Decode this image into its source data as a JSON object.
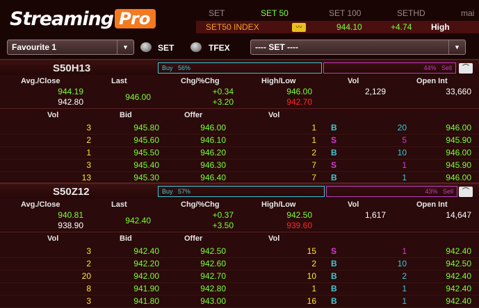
{
  "header": {
    "logo_part1": "Streaming",
    "logo_part2": "Pro",
    "market_tabs": [
      "SET",
      "SET 50",
      "SET 100",
      "SETHD",
      "mai"
    ],
    "index": {
      "name": "SET50 INDEX",
      "value": "944.10",
      "change": "+4.74",
      "level": "High"
    }
  },
  "toolbar": {
    "favourite": "Favourite 1",
    "radio_set": "SET",
    "radio_tfex": "TFEX",
    "market_select": "---- SET ----"
  },
  "labels": {
    "avg_close": "Avg./Close",
    "last": "Last",
    "chg": "Chg/%Chg",
    "high_low": "High/Low",
    "vol": "Vol",
    "open_int": "Open Int",
    "bid": "Bid",
    "offer": "Offer"
  },
  "symbols": [
    {
      "name": "S50H13",
      "buy_label": "Buy",
      "buy_pct": "56%",
      "sell_pct": "44%",
      "sell_label": "Sell",
      "avg": "944.19",
      "close": "942.80",
      "last": "946.00",
      "chg": "+0.34",
      "pchg": "+3.20",
      "high": "946.00",
      "low": "942.70",
      "vol": "2,129",
      "open_int": "33,660",
      "bidvol": [
        "3",
        "2",
        "1",
        "3",
        "13"
      ],
      "bid": [
        "945.80",
        "945.60",
        "945.50",
        "945.40",
        "945.30"
      ],
      "offer": [
        "946.00",
        "946.10",
        "946.20",
        "946.30",
        "946.40"
      ],
      "offervol": [
        "1",
        "1",
        "2",
        "7",
        "7"
      ],
      "side": [
        "B",
        "S",
        "B",
        "S",
        "B"
      ],
      "tvol": [
        "20",
        "5",
        "10",
        "1",
        "1"
      ],
      "tprice": [
        "946.00",
        "945.90",
        "946.00",
        "945.90",
        "946.00"
      ]
    },
    {
      "name": "S50Z12",
      "buy_label": "Buy",
      "buy_pct": "57%",
      "sell_pct": "43%",
      "sell_label": "Sell",
      "avg": "940.81",
      "close": "938.90",
      "last": "942.40",
      "chg": "+0.37",
      "pchg": "+3.50",
      "high": "942.50",
      "low": "939.60",
      "vol": "1,617",
      "open_int": "14,647",
      "bidvol": [
        "3",
        "2",
        "20",
        "8",
        "3"
      ],
      "bid": [
        "942.40",
        "942.20",
        "942.00",
        "941.90",
        "941.80"
      ],
      "offer": [
        "942.50",
        "942.60",
        "942.70",
        "942.80",
        "943.00"
      ],
      "offervol": [
        "15",
        "2",
        "10",
        "1",
        "16"
      ],
      "side": [
        "S",
        "B",
        "B",
        "B",
        "B"
      ],
      "tvol": [
        "1",
        "10",
        "2",
        "1",
        "1"
      ],
      "tprice": [
        "942.40",
        "942.50",
        "942.40",
        "942.40",
        "942.40"
      ]
    }
  ],
  "colors": {
    "up": "#7cff3a",
    "down": "#ff2a2a",
    "buy": "#3cc9d8",
    "sell": "#d83cd8",
    "vol": "#ffea2a"
  }
}
